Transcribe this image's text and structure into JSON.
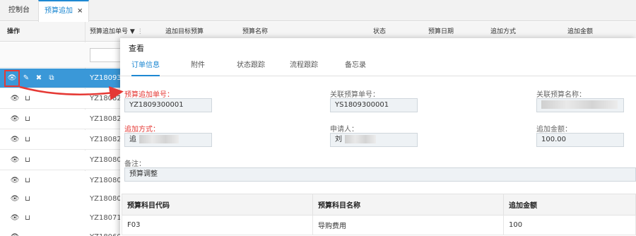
{
  "tabs": [
    {
      "label": "控制台"
    },
    {
      "label": "预算追加",
      "close": "×"
    }
  ],
  "grid": {
    "columns": [
      "操作",
      "预算追加单号",
      "追加目标预算",
      "预算名称",
      "状态",
      "预算日期",
      "追加方式",
      "追加金额"
    ],
    "sort_marker": "▼",
    "more": "⋮",
    "rows": [
      {
        "code": "YZ18093"
      },
      {
        "code": "YZ18082"
      },
      {
        "code": "YZ18082"
      },
      {
        "code": "YZ18082"
      },
      {
        "code": "YZ18080"
      },
      {
        "code": "YZ18080"
      },
      {
        "code": "YZ18080"
      },
      {
        "code": "YZ18071"
      },
      {
        "code": "YZ18060"
      }
    ]
  },
  "modal": {
    "title": "查看",
    "tabs": [
      "订单信息",
      "附件",
      "状态跟踪",
      "流程跟踪",
      "备忘录"
    ],
    "fields": {
      "budget_add_no": {
        "label": "预算追加单号：",
        "value": "YZ1809300001"
      },
      "related_budget_no": {
        "label": "关联预算单号：",
        "value": "YS1809300001"
      },
      "related_budget_name": {
        "label": "关联预算名称："
      },
      "add_method": {
        "label": "追加方式：",
        "value": "追"
      },
      "applicant": {
        "label": "申请人：",
        "value": "刘"
      },
      "add_amount": {
        "label": "追加金额：",
        "value": "100.00"
      },
      "remark": {
        "label": "备注：",
        "value": "预算调整"
      }
    },
    "detail_table": {
      "headers": [
        "预算科目代码",
        "预算科目名称",
        "追加金额"
      ],
      "rows": [
        [
          "F03",
          "导购费用",
          "100"
        ]
      ]
    }
  },
  "colors": {
    "accent": "#1e88d2",
    "selected_row": "#3a98d8",
    "required": "#e53935"
  }
}
